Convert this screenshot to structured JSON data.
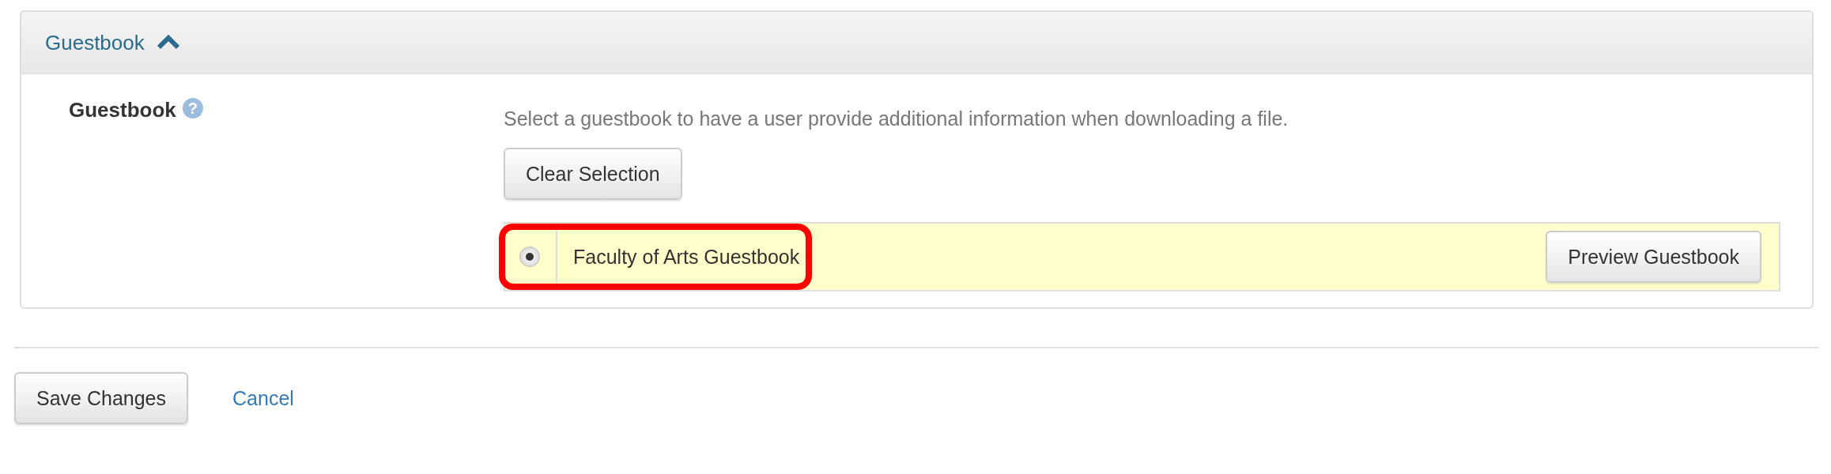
{
  "panel": {
    "title": "Guestbook",
    "expanded": true
  },
  "field": {
    "label": "Guestbook",
    "help": "?",
    "description": "Select a guestbook to have a user provide additional information when downloading a file.",
    "clear_button": "Clear Selection"
  },
  "guestbooks": [
    {
      "name": "Faculty of Arts Guestbook",
      "selected": true,
      "highlighted": true,
      "preview_button": "Preview Guestbook"
    }
  ],
  "actions": {
    "save": "Save Changes",
    "cancel": "Cancel"
  }
}
